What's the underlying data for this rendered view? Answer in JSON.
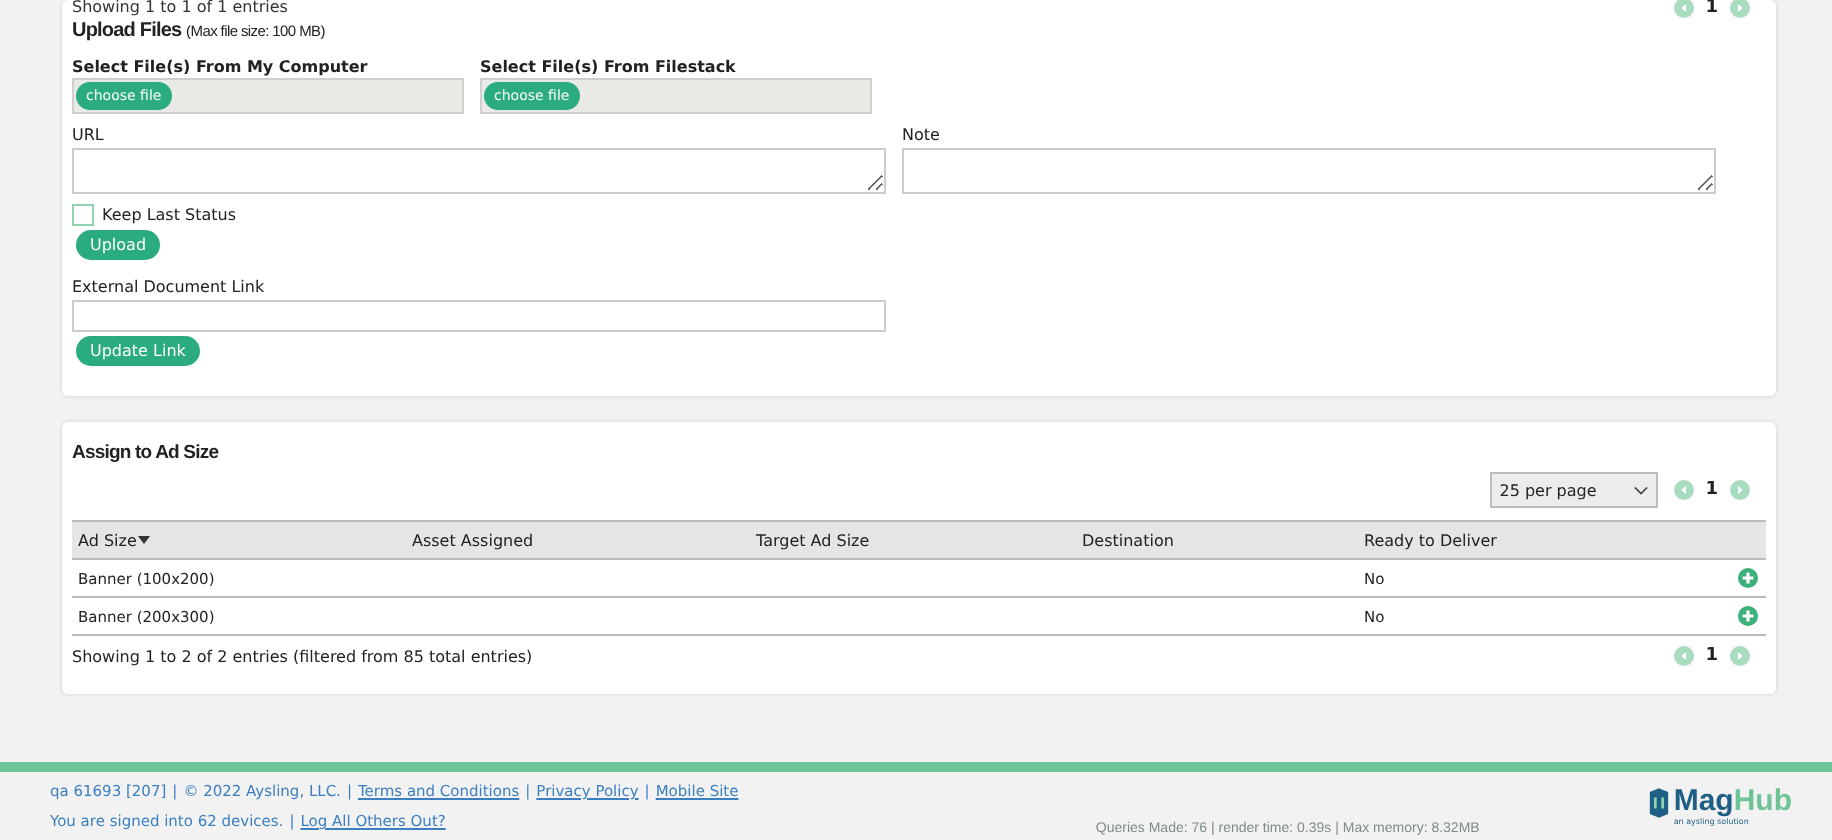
{
  "top_table": {
    "info": "Showing 1 to 1 of 1 entries",
    "pager": {
      "page": "1",
      "prev_disabled": true,
      "next_disabled": true
    }
  },
  "upload": {
    "title": "Upload Files",
    "size_note": "(Max file size: 100 MB)",
    "sources": [
      {
        "label": "Select File(s) From My Computer",
        "button": "choose file"
      },
      {
        "label": "Select File(s) From Filestack",
        "button": "choose file"
      }
    ],
    "url_label": "URL",
    "note_label": "Note",
    "keep_last_status": {
      "label": "Keep Last Status",
      "checked": false
    },
    "upload_button": "Upload",
    "external_link_label": "External Document Link",
    "update_button": "Update Link"
  },
  "assign": {
    "title": "Assign to Ad Size",
    "per_page": "25 per page",
    "pager_top": {
      "page": "1",
      "prev_disabled": true,
      "next_disabled": true
    },
    "columns": [
      {
        "label": "Ad Size",
        "sorted": true
      },
      {
        "label": "Asset Assigned",
        "sorted": false
      },
      {
        "label": "Target Ad Size",
        "sorted": false
      },
      {
        "label": "Destination",
        "sorted": false
      },
      {
        "label": "Ready to Deliver",
        "sorted": false
      }
    ],
    "rows": [
      {
        "ad_size": "Banner (100x200)",
        "ready_to_deliver": "No"
      },
      {
        "ad_size": "Banner (200x300)",
        "ready_to_deliver": "No"
      }
    ],
    "info": "Showing 1 to 2 of 2 entries (filtered from 85 total entries)",
    "pager_bottom": {
      "page": "1",
      "prev_disabled": true,
      "next_disabled": true
    }
  },
  "footer": {
    "separator": "|",
    "line1": [
      {
        "text": "qa 61693 [207]",
        "link": false
      },
      {
        "text": "© 2022 Aysling, LLC.",
        "link": false
      },
      {
        "text": "Terms and Conditions",
        "link": true
      },
      {
        "text": "Privacy Policy",
        "link": true
      },
      {
        "text": "Mobile Site",
        "link": true
      }
    ],
    "line2": [
      {
        "text": "You are signed into 62 devices.",
        "link": false
      },
      {
        "text": "Log All Others Out?",
        "link": true
      }
    ],
    "stats": "Queries Made: 76 | render time: 0.39s | Max memory: 8.32MB",
    "logo": {
      "mag": "Mag",
      "hub": "Hub",
      "tagline": "an aysling solution"
    }
  }
}
